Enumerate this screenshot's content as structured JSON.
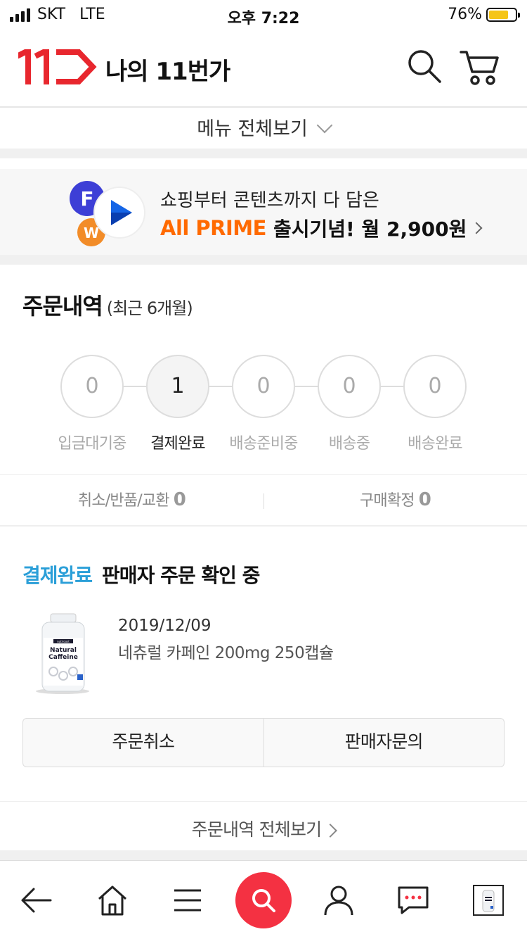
{
  "status_bar": {
    "carrier": "SKT",
    "network": "LTE",
    "time": "오후 7:22",
    "battery_percent": "76%",
    "battery_level": 0.76,
    "battery_color": "#f5c518"
  },
  "header": {
    "title": "나의 11번가",
    "logo": "11st-logo",
    "icons": [
      "search-icon",
      "cart-icon"
    ]
  },
  "menu": {
    "label": "메뉴 전체보기"
  },
  "banner": {
    "line1": "쇼핑부터 콘텐츠까지 다 담은",
    "brand": "All PRIME",
    "line2": "출시기념! 월 2,900원"
  },
  "orders": {
    "title": "주문내역",
    "subtitle": "(최근 6개월)",
    "steps": [
      {
        "count": "0",
        "label": "입금대기중"
      },
      {
        "count": "1",
        "label": "결제완료"
      },
      {
        "count": "0",
        "label": "배송준비중"
      },
      {
        "count": "0",
        "label": "배송중"
      },
      {
        "count": "0",
        "label": "배송완료"
      }
    ],
    "cancel": {
      "label": "취소/반품/교환",
      "count": "0"
    },
    "confirm": {
      "label": "구매확정",
      "count": "0"
    }
  },
  "order_item": {
    "status": "결제완료",
    "status_color": "#2b9fd8",
    "message": "판매자 주문 확인 중",
    "date": "2019/12/09",
    "product_name": "네츄럴 카페인 200mg 250캡슐",
    "product_label_brand": "nutricost",
    "product_label_line1": "Natural",
    "product_label_line2": "Caffeine",
    "buttons": {
      "cancel": "주문취소",
      "inquiry": "판매자문의"
    }
  },
  "view_all": {
    "label": "주문내역 전체보기"
  },
  "bottom_nav": {
    "items": [
      "back-icon",
      "home-icon",
      "menu-icon",
      "search-icon",
      "user-icon",
      "chat-icon",
      "recent-item-thumb"
    ],
    "accent": "#f43142"
  }
}
